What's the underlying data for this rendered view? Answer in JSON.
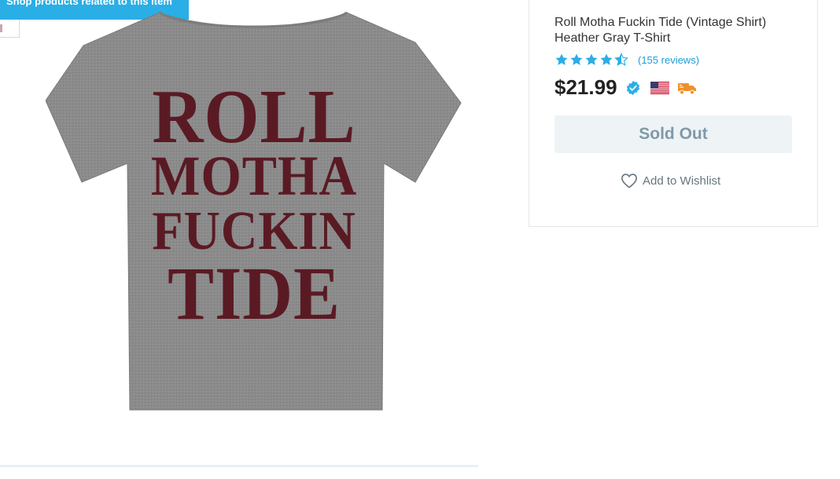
{
  "related": {
    "label": "Shop products related to this item"
  },
  "product": {
    "print_lines": [
      "ROLL",
      "MOTHA",
      "FUCKIN",
      "TIDE"
    ],
    "shirt_color": "#8c8c8c",
    "print_color": "#5a1a24"
  },
  "panel": {
    "title": "Roll Motha Fuckin Tide (Vintage Shirt) Heather Gray T-Shirt",
    "rating": {
      "stars": 4.5,
      "reviews_label": "(155 reviews)"
    },
    "price": "$21.99",
    "icons": [
      "verified-badge-icon",
      "us-flag-icon",
      "shipping-truck-icon"
    ],
    "sold_out_label": "Sold Out",
    "wishlist_label": "Add to Wishlist"
  },
  "colors": {
    "accent": "#2aaee6",
    "star": "#2aaee6",
    "truck": "#f0902a"
  }
}
